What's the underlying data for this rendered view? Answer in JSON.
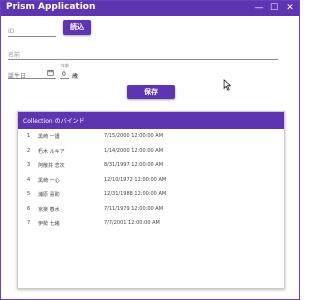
{
  "window": {
    "title": "Prism Application",
    "controls": {
      "minimize": "—",
      "maximize": "☐",
      "close": "✕"
    }
  },
  "form": {
    "id_placeholder": "ID",
    "load_button": "読込",
    "name_placeholder": "名前",
    "dob_label": "誕生日",
    "age_caption": "年齢",
    "age_value": "0",
    "age_unit": "歳",
    "save_button": "保存"
  },
  "collection": {
    "title": "Collection のバインド",
    "rows": [
      {
        "no": "1",
        "name": "黒崎 一護",
        "date": "7/15/2000 12:00:00 AM"
      },
      {
        "no": "2",
        "name": "朽木 ルキア",
        "date": "1/14/2000 12:00:00 AM"
      },
      {
        "no": "3",
        "name": "阿散井 恋次",
        "date": "8/31/1997 12:00:00 AM"
      },
      {
        "no": "4",
        "name": "黒崎 一心",
        "date": "12/10/1972 12:00:00 AM"
      },
      {
        "no": "5",
        "name": "浦原 喜助",
        "date": "12/31/1988 12:00:00 AM"
      },
      {
        "no": "6",
        "name": "京楽 春水",
        "date": "7/11/1979 12:00:00 AM"
      },
      {
        "no": "7",
        "name": "伊勢 七緒",
        "date": "7/7/2001 12:00:00 AM"
      }
    ]
  },
  "colors": {
    "accent": "#5e35b1"
  }
}
